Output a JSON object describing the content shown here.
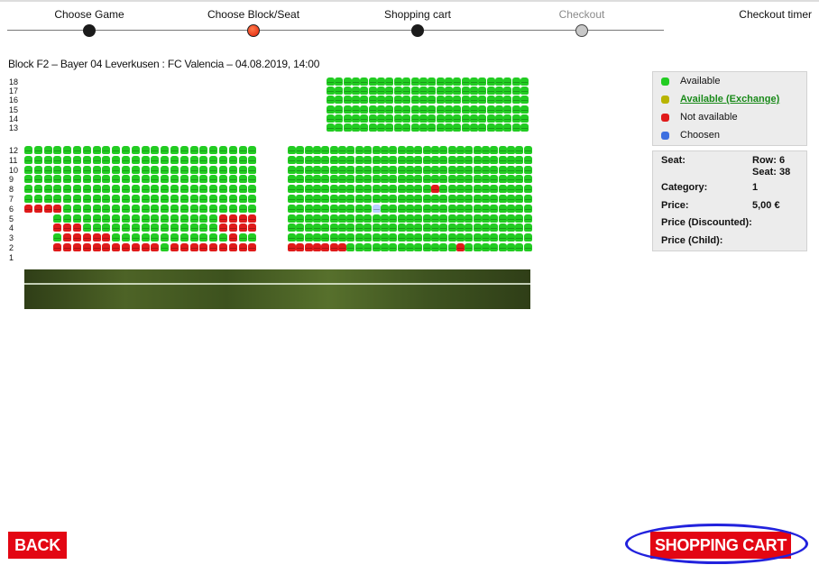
{
  "stepper": {
    "steps": [
      {
        "label": "Choose Game",
        "state": "done"
      },
      {
        "label": "Choose Block/Seat",
        "state": "active"
      },
      {
        "label": "Shopping cart",
        "state": "done"
      },
      {
        "label": "Checkout",
        "state": "disabled"
      }
    ],
    "timer_label": "Checkout timer"
  },
  "block_title": "Block F2 – Bayer 04 Leverkusen : FC Valencia – 04.08.2019, 14:00",
  "seatmap": {
    "upper_rows": [
      "18",
      "17",
      "16",
      "15",
      "14",
      "13"
    ],
    "lower_rows": [
      "12",
      "11",
      "10",
      "9",
      "8",
      "7",
      "6",
      "5",
      "4",
      "3",
      "2",
      "1"
    ],
    "seat_rows": [
      {
        "row": 12,
        "left": "GGGGGGGGGGGGGGGGGGGGGGGG",
        "right": "GGGGGGGGGGGGGGGGGGGGGGGGGGGGG"
      },
      {
        "row": 11,
        "left": "GGGGGGGGGGGGGGGGGGGGGGGG",
        "right": "GGGGGGGGGGGGGGGGGGGGGGGGGGGGG"
      },
      {
        "row": 10,
        "left": "GGGGGGGGGGGGGGGGGGGGGGGG",
        "right": "GGGGGGGGGGGGGGGGGGGGGGGGGGGGG"
      },
      {
        "row": 9,
        "left": "GGGGGGGGGGGGGGGGGGGGGGGG",
        "right": "GGGGGGGGGGGGGGGGGGGGGGGGGGGGG"
      },
      {
        "row": 8,
        "left": "GGGGGGGGGGGGGGGGGGGGGGGG",
        "right": "GGGGGGGGGGGGGGGGGRGGGGGGGGGGG"
      },
      {
        "row": 7,
        "left": "GGGGGGGGGGGGGGGGGGGGGGGG",
        "right": "GGGGGGGGGGGGGGGGGGGGGGGGGGGGG"
      },
      {
        "row": 6,
        "left": "RRRRGGGGGGGGGGGGGGGGGGGG",
        "right": "GGGGGGGGGGCGGGGGGGGGGGGGGGGGG"
      },
      {
        "row": 5,
        "left": "...GGGGGGGGGGGGGGGGGRRRR",
        "right": "GGGGGGGGGGGGGGGGGGGGGGGGGGGGG"
      },
      {
        "row": 4,
        "left": "...RRRGGGGGGGGGGGGGGRRRR",
        "right": "GGGGGGGGGGGGGGGGGGGGGGGGGGGGG"
      },
      {
        "row": 3,
        "left": "...GRRRRRGGGGGGGGGGGGRGG",
        "right": "GGGGGGGGGGGGGGGGGGGGGGGGGGGGG"
      },
      {
        "row": 2,
        "left": "...RRRRRRRRRRRGRRRRRRRRR",
        "right": "RRRRRRRGGGGGGGGGGGGGRGGGGGGGG"
      },
      {
        "row": 1,
        "left": "",
        "right": ""
      }
    ],
    "upper_block": {
      "rows": 6,
      "cols": 24,
      "status": "available"
    }
  },
  "legend": {
    "available": "Available",
    "exchange": "Available (Exchange)",
    "not_available": "Not available",
    "chosen": "Choosen"
  },
  "seat_info": {
    "seat_label": "Seat:",
    "row_value": "Row: 6",
    "seat_value": "Seat: 38",
    "category_label": "Category:",
    "category_value": "1",
    "price_label": "Price:",
    "price_value": "5,00 €",
    "price_discounted_label": "Price (Discounted):",
    "price_child_label": "Price (Child):"
  },
  "buttons": {
    "back": "BACK",
    "shopping_cart": "SHOPPING CART"
  },
  "colors": {
    "available": "#22cc22",
    "exchange": "#b8b400",
    "not_available": "#e01a1a",
    "chosen": "#3d6fe0",
    "brand_red": "#e30613"
  }
}
